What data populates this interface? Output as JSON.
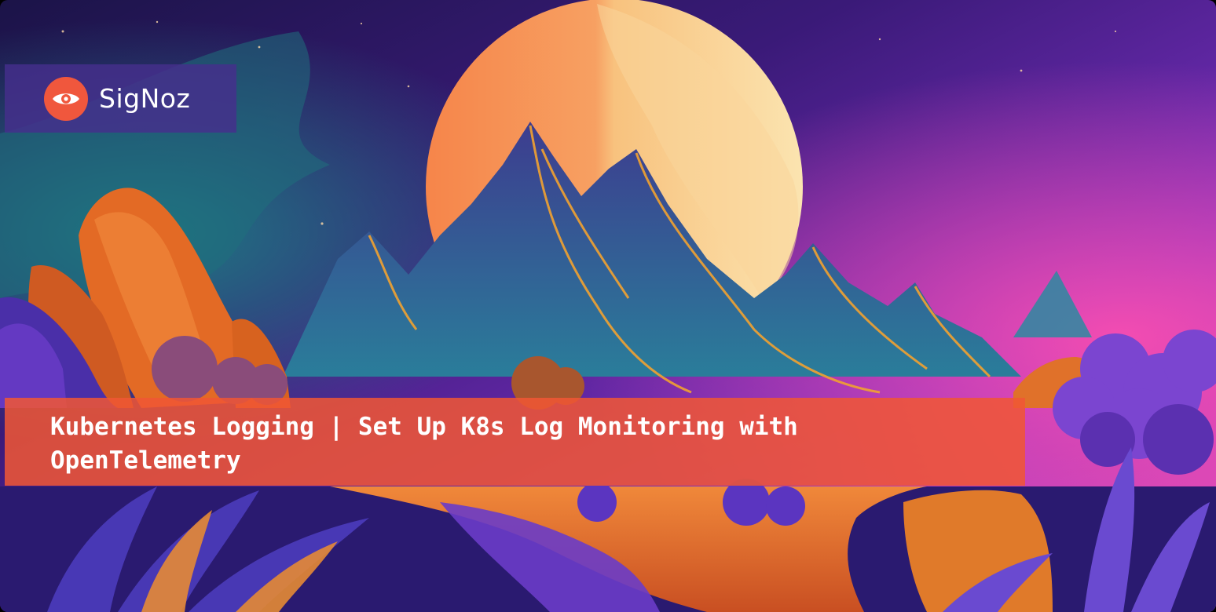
{
  "brand": {
    "name": "SigNoz",
    "logo_icon": "signoz-eye-icon",
    "logo_color": "#f0573d"
  },
  "article": {
    "title": "Kubernetes Logging | Set Up K8s Log Monitoring with OpenTelemetry"
  },
  "illustration": {
    "subject": "stylized purple and orange mountain landscape with a large orange moon"
  },
  "colors": {
    "title_band": "#f0573d",
    "logo_panel": "#462e8c",
    "sky_purple": "#6a2bb4",
    "sky_pink": "#f04fb8",
    "moon": "#f5945a"
  }
}
